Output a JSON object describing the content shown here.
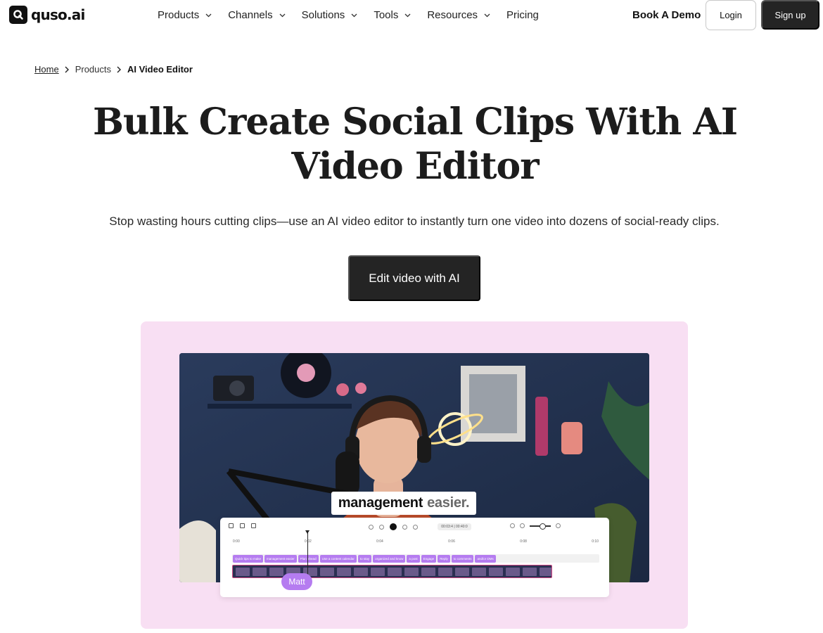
{
  "brand": {
    "name": "quso.ai"
  },
  "nav": {
    "items": [
      {
        "label": "Products",
        "dropdown": true
      },
      {
        "label": "Channels",
        "dropdown": true
      },
      {
        "label": "Solutions",
        "dropdown": true
      },
      {
        "label": "Tools",
        "dropdown": true
      },
      {
        "label": "Resources",
        "dropdown": true
      },
      {
        "label": "Pricing",
        "dropdown": false
      }
    ],
    "book_demo": "Book A Demo",
    "login": "Login",
    "signup": "Sign up"
  },
  "breadcrumb": {
    "home": "Home",
    "parent": "Products",
    "current": "AI Video Editor"
  },
  "hero": {
    "title": "Bulk Create Social Clips With AI Video Editor",
    "subtitle": "Stop wasting hours cutting clips—use an AI video editor to instantly turn one video into dozens of social-ready clips.",
    "cta": "Edit video with AI"
  },
  "showcase": {
    "caption_bold": "management",
    "caption_muted": "easier.",
    "speaker": "Matt",
    "timecode": "00:03:4 | 00:40:0",
    "ruler": [
      "0:00",
      "0:02",
      "0:04",
      "0:06",
      "0:08",
      "0:10"
    ],
    "clips": [
      "Quick tips to make",
      "management easier",
      "Plan ahead",
      "Use a content calendar",
      "to stay",
      "organized and know",
      "a post",
      "Engage",
      "Reply",
      "to comments",
      "and/or DMs"
    ]
  },
  "colors": {
    "showcase_bg": "#f8dff3",
    "clip_purple": "#b57cf0",
    "button_dark": "#242424"
  }
}
